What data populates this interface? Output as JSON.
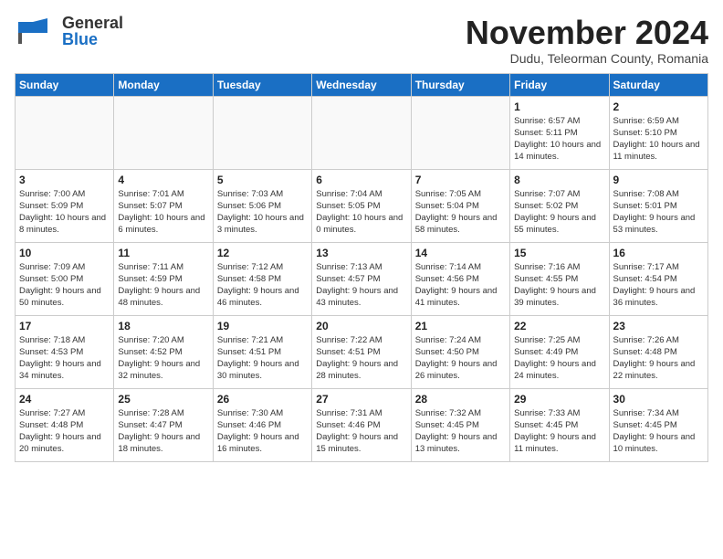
{
  "header": {
    "logo_general": "General",
    "logo_blue": "Blue",
    "month_title": "November 2024",
    "location": "Dudu, Teleorman County, Romania"
  },
  "weekdays": [
    "Sunday",
    "Monday",
    "Tuesday",
    "Wednesday",
    "Thursday",
    "Friday",
    "Saturday"
  ],
  "weeks": [
    [
      {
        "day": "",
        "info": ""
      },
      {
        "day": "",
        "info": ""
      },
      {
        "day": "",
        "info": ""
      },
      {
        "day": "",
        "info": ""
      },
      {
        "day": "",
        "info": ""
      },
      {
        "day": "1",
        "info": "Sunrise: 6:57 AM\nSunset: 5:11 PM\nDaylight: 10 hours and 14 minutes."
      },
      {
        "day": "2",
        "info": "Sunrise: 6:59 AM\nSunset: 5:10 PM\nDaylight: 10 hours and 11 minutes."
      }
    ],
    [
      {
        "day": "3",
        "info": "Sunrise: 7:00 AM\nSunset: 5:09 PM\nDaylight: 10 hours and 8 minutes."
      },
      {
        "day": "4",
        "info": "Sunrise: 7:01 AM\nSunset: 5:07 PM\nDaylight: 10 hours and 6 minutes."
      },
      {
        "day": "5",
        "info": "Sunrise: 7:03 AM\nSunset: 5:06 PM\nDaylight: 10 hours and 3 minutes."
      },
      {
        "day": "6",
        "info": "Sunrise: 7:04 AM\nSunset: 5:05 PM\nDaylight: 10 hours and 0 minutes."
      },
      {
        "day": "7",
        "info": "Sunrise: 7:05 AM\nSunset: 5:04 PM\nDaylight: 9 hours and 58 minutes."
      },
      {
        "day": "8",
        "info": "Sunrise: 7:07 AM\nSunset: 5:02 PM\nDaylight: 9 hours and 55 minutes."
      },
      {
        "day": "9",
        "info": "Sunrise: 7:08 AM\nSunset: 5:01 PM\nDaylight: 9 hours and 53 minutes."
      }
    ],
    [
      {
        "day": "10",
        "info": "Sunrise: 7:09 AM\nSunset: 5:00 PM\nDaylight: 9 hours and 50 minutes."
      },
      {
        "day": "11",
        "info": "Sunrise: 7:11 AM\nSunset: 4:59 PM\nDaylight: 9 hours and 48 minutes."
      },
      {
        "day": "12",
        "info": "Sunrise: 7:12 AM\nSunset: 4:58 PM\nDaylight: 9 hours and 46 minutes."
      },
      {
        "day": "13",
        "info": "Sunrise: 7:13 AM\nSunset: 4:57 PM\nDaylight: 9 hours and 43 minutes."
      },
      {
        "day": "14",
        "info": "Sunrise: 7:14 AM\nSunset: 4:56 PM\nDaylight: 9 hours and 41 minutes."
      },
      {
        "day": "15",
        "info": "Sunrise: 7:16 AM\nSunset: 4:55 PM\nDaylight: 9 hours and 39 minutes."
      },
      {
        "day": "16",
        "info": "Sunrise: 7:17 AM\nSunset: 4:54 PM\nDaylight: 9 hours and 36 minutes."
      }
    ],
    [
      {
        "day": "17",
        "info": "Sunrise: 7:18 AM\nSunset: 4:53 PM\nDaylight: 9 hours and 34 minutes."
      },
      {
        "day": "18",
        "info": "Sunrise: 7:20 AM\nSunset: 4:52 PM\nDaylight: 9 hours and 32 minutes."
      },
      {
        "day": "19",
        "info": "Sunrise: 7:21 AM\nSunset: 4:51 PM\nDaylight: 9 hours and 30 minutes."
      },
      {
        "day": "20",
        "info": "Sunrise: 7:22 AM\nSunset: 4:51 PM\nDaylight: 9 hours and 28 minutes."
      },
      {
        "day": "21",
        "info": "Sunrise: 7:24 AM\nSunset: 4:50 PM\nDaylight: 9 hours and 26 minutes."
      },
      {
        "day": "22",
        "info": "Sunrise: 7:25 AM\nSunset: 4:49 PM\nDaylight: 9 hours and 24 minutes."
      },
      {
        "day": "23",
        "info": "Sunrise: 7:26 AM\nSunset: 4:48 PM\nDaylight: 9 hours and 22 minutes."
      }
    ],
    [
      {
        "day": "24",
        "info": "Sunrise: 7:27 AM\nSunset: 4:48 PM\nDaylight: 9 hours and 20 minutes."
      },
      {
        "day": "25",
        "info": "Sunrise: 7:28 AM\nSunset: 4:47 PM\nDaylight: 9 hours and 18 minutes."
      },
      {
        "day": "26",
        "info": "Sunrise: 7:30 AM\nSunset: 4:46 PM\nDaylight: 9 hours and 16 minutes."
      },
      {
        "day": "27",
        "info": "Sunrise: 7:31 AM\nSunset: 4:46 PM\nDaylight: 9 hours and 15 minutes."
      },
      {
        "day": "28",
        "info": "Sunrise: 7:32 AM\nSunset: 4:45 PM\nDaylight: 9 hours and 13 minutes."
      },
      {
        "day": "29",
        "info": "Sunrise: 7:33 AM\nSunset: 4:45 PM\nDaylight: 9 hours and 11 minutes."
      },
      {
        "day": "30",
        "info": "Sunrise: 7:34 AM\nSunset: 4:45 PM\nDaylight: 9 hours and 10 minutes."
      }
    ]
  ]
}
